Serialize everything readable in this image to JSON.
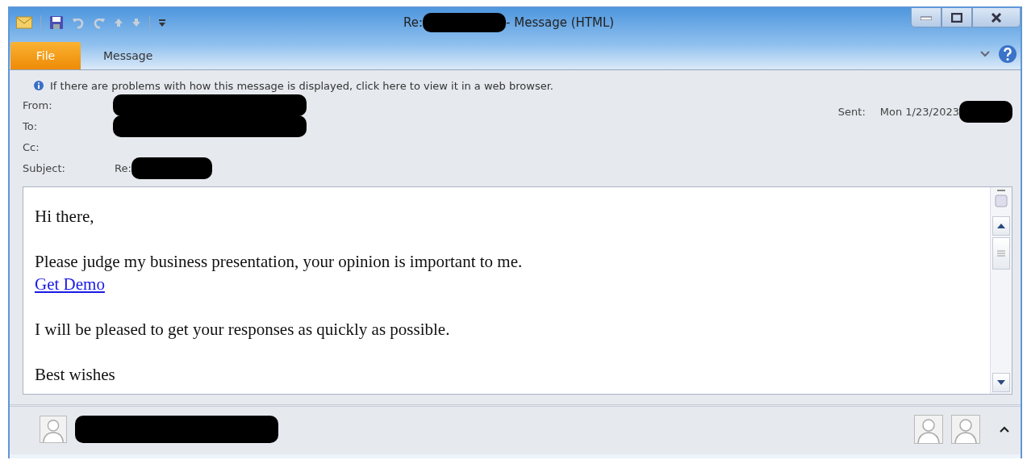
{
  "window": {
    "title_prefix": "Re:",
    "title_redacted": true,
    "title_suffix": "- Message (HTML)"
  },
  "tabs": [
    {
      "label": "File",
      "kind": "backstage"
    },
    {
      "label": "Message",
      "kind": "tab"
    }
  ],
  "infobar": {
    "text": "If there are problems with how this message is displayed, click here to view it in a web browser."
  },
  "header_fields": [
    {
      "label": "From:",
      "redacted": true
    },
    {
      "label": "To:",
      "redacted": true
    },
    {
      "label": "Cc:",
      "redacted": false
    },
    {
      "label": "Subject:",
      "value": "Re:",
      "redacted": true
    }
  ],
  "sent": {
    "label": "Sent:",
    "value": "Mon 1/23/2023",
    "redacted": true
  },
  "body": [
    {
      "lines": [
        {
          "kind": "text",
          "text": "Hi there,"
        }
      ]
    },
    {
      "lines": [
        {
          "kind": "text",
          "text": "Please judge my business presentation, your opinion is important to me."
        },
        {
          "kind": "link",
          "text": "Get Demo"
        }
      ]
    },
    {
      "lines": [
        {
          "kind": "text",
          "text": "I will be pleased to get your responses as quickly as possible."
        }
      ]
    },
    {
      "lines": [
        {
          "kind": "text",
          "text": "Best wishes"
        }
      ]
    }
  ],
  "people_pane": {
    "redacted": true
  }
}
